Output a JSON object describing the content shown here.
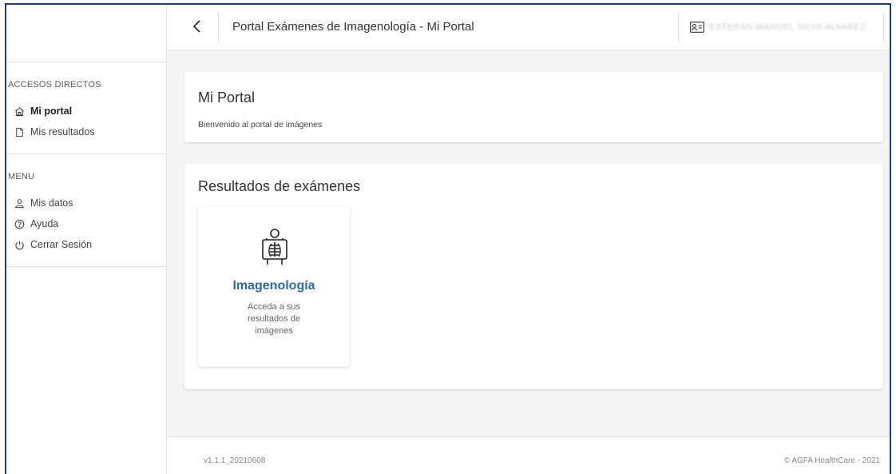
{
  "header": {
    "title": "Portal Exámenes de Imagenología - Mi Portal",
    "user_name": "ESTEBAN MANUEL SILVA ALVAREZ"
  },
  "sidebar": {
    "sections": [
      {
        "title": "ACCESOS DIRECTOS",
        "items": [
          {
            "label": "Mi portal",
            "icon": "home-icon",
            "active": true
          },
          {
            "label": "Mis resultados",
            "icon": "document-icon",
            "active": false
          }
        ]
      },
      {
        "title": "MENU",
        "items": [
          {
            "label": "Mis datos",
            "icon": "user-icon",
            "active": false
          },
          {
            "label": "Ayuda",
            "icon": "help-icon",
            "active": false
          },
          {
            "label": "Cerrar Sesión",
            "icon": "power-icon",
            "active": false
          }
        ]
      }
    ]
  },
  "portal_card": {
    "title": "Mi Portal",
    "subtitle": "Bienvenido al portal de imágenes"
  },
  "results_card": {
    "title": "Resultados de exámenes",
    "tile": {
      "icon": "xray-icon",
      "title": "Imagenología",
      "description_lines": [
        "Acceda a sus",
        "resultados de",
        "imágenes"
      ]
    }
  },
  "footer": {
    "version": "v1.1.1_20210608",
    "copyright": "© AGFA HealthCare - 2021"
  },
  "colors": {
    "frame_border": "#1f3f7a",
    "tile_title": "#2f6aa7",
    "background": "#f3f4f5"
  }
}
